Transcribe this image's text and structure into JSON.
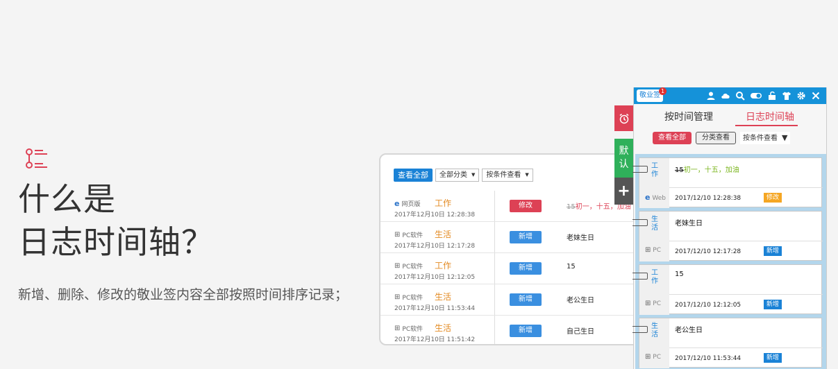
{
  "hero": {
    "title_line1": "什么是",
    "title_line2": "日志时间轴？",
    "description": "新增、删除、修改的敬业签内容全部按照时间排序记录；"
  },
  "card": {
    "toolbar": {
      "view_all": "查看全部",
      "category_select": "全部分类",
      "condition_select": "按条件查看"
    },
    "rows": [
      {
        "source": "网页版",
        "category": "工作",
        "time": "2017年12月10日 12:28:38",
        "action": "修改",
        "content_strike": "15",
        "content": "初一，十五，加油"
      },
      {
        "source": "PC软件",
        "category": "生活",
        "time": "2017年12月10日 12:17:28",
        "action": "新增",
        "content_strike": "",
        "content": "老妹生日"
      },
      {
        "source": "PC软件",
        "category": "工作",
        "time": "2017年12月10日 12:12:05",
        "action": "新增",
        "content_strike": "",
        "content": "15"
      },
      {
        "source": "PC软件",
        "category": "生活",
        "time": "2017年12月10日 11:53:44",
        "action": "新增",
        "content_strike": "",
        "content": "老公生日"
      },
      {
        "source": "PC软件",
        "category": "生活",
        "time": "2017年12月10日 11:51:42",
        "action": "新增",
        "content_strike": "",
        "content": "自己生日"
      }
    ]
  },
  "side_tabs": {
    "default_label": "默认",
    "add_label": "+"
  },
  "panel": {
    "brand": "敬业签",
    "badge_count": "1",
    "icons": [
      "user-icon",
      "cloud-icon",
      "search-icon",
      "toggle-icon",
      "unlock-icon",
      "shirt-icon",
      "gear-icon",
      "close-icon"
    ],
    "tabs": {
      "time_manage": "按时间管理",
      "log_timeline": "日志时间轴"
    },
    "filters": {
      "view_all": "查看全部",
      "by_category": "分类查看",
      "by_condition": "按条件查看"
    },
    "items": [
      {
        "category": "工作",
        "source": "Web",
        "text_strike": "15",
        "text": "初一，十五，加油",
        "time": "2017/12/10 12:28:38",
        "tag": "修改"
      },
      {
        "category": "生活",
        "source": "PC",
        "text_strike": "",
        "text": "老妹生日",
        "time": "2017/12/10 12:17:28",
        "tag": "新增"
      },
      {
        "category": "工作",
        "source": "PC",
        "text_strike": "",
        "text": "15",
        "time": "2017/12/10 12:12:05",
        "tag": "新增"
      },
      {
        "category": "生活",
        "source": "PC",
        "text_strike": "",
        "text": "老公生日",
        "time": "2017/12/10 11:53:44",
        "tag": "新增"
      }
    ]
  },
  "colors": {
    "accent_red": "#dd4155",
    "accent_blue": "#1a82d6",
    "accent_green": "#2fb05a",
    "orange": "#e38a22"
  }
}
